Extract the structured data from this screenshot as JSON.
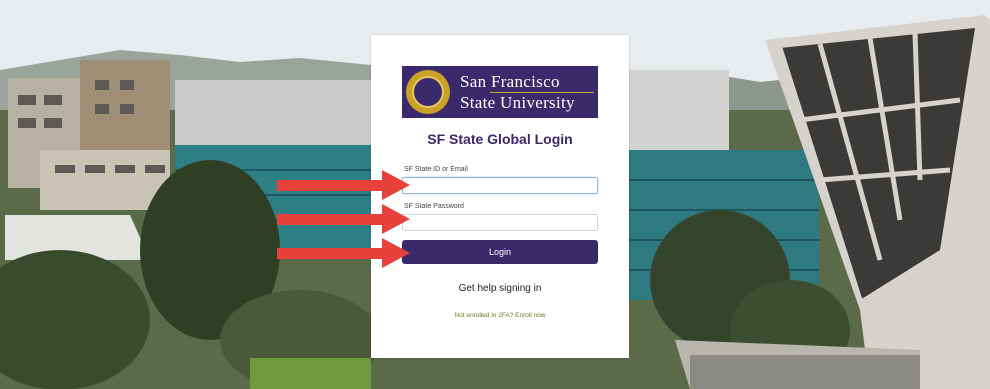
{
  "logo": {
    "line1": "San Francisco",
    "line2": "State University"
  },
  "login": {
    "title": "SF State Global Login",
    "id_label": "SF State ID or Email",
    "id_value": "",
    "password_label": "SF State Password",
    "password_value": "",
    "button_label": "Login",
    "help_link": "Get help signing in",
    "enroll_link": "Not enrolled in 2FA? Enroll now"
  },
  "colors": {
    "brand_purple": "#3b2a6b",
    "brand_gold": "#c9a227",
    "arrow_red": "#e8403a",
    "enroll_link": "#6b7a22"
  },
  "icons": {
    "seal": "university-seal-icon",
    "arrows": "red-arrow-icon"
  }
}
